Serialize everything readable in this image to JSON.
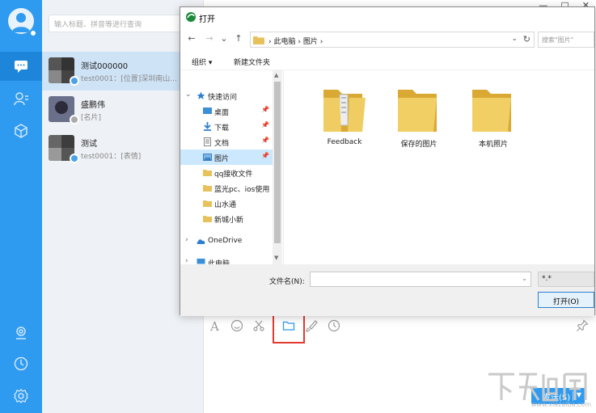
{
  "app": {
    "search_placeholder": "输入标题、拼音等进行查询",
    "window_controls": [
      "—",
      "□",
      "✕"
    ]
  },
  "rail": {
    "icons": [
      "user-avatar",
      "chat-icon",
      "contacts-icon",
      "cube-icon",
      "location-icon",
      "clock-icon",
      "settings-icon"
    ]
  },
  "conversations": [
    {
      "name": "测试000000",
      "preview": "test0001：[位置]深圳南山...",
      "active": true
    },
    {
      "name": "盛鹏伟",
      "preview": "[名片]",
      "active": false
    },
    {
      "name": "测试",
      "preview": "test0001：[表情]",
      "active": false
    }
  ],
  "dialog": {
    "title": "打开",
    "nav": {
      "back": "←",
      "forward": "→",
      "recent": "⌄",
      "up": "↑"
    },
    "breadcrumb": [
      "此电脑",
      "›",
      "图片",
      "›"
    ],
    "search_placeholder": "搜索\"图片\"",
    "commands": {
      "organize": "组织 ▾",
      "new_folder": "新建文件夹"
    },
    "nav_pane": {
      "quick_access": "快速访问",
      "items": [
        {
          "label": "桌面",
          "pinned": true
        },
        {
          "label": "下载",
          "pinned": true
        },
        {
          "label": "文档",
          "pinned": true
        },
        {
          "label": "图片",
          "pinned": true,
          "selected": true
        },
        {
          "label": "qq接收文件",
          "pinned": false
        },
        {
          "label": "蓝光pc、ios使用",
          "pinned": false
        },
        {
          "label": "山水通",
          "pinned": false
        },
        {
          "label": "新城小新",
          "pinned": false
        }
      ],
      "onedrive": "OneDrive",
      "this_pc": "此电脑"
    },
    "files": [
      "Feedback",
      "保存的图片",
      "本机照片"
    ],
    "filename_label": "文件名(N):",
    "filename_value": "",
    "file_type": "*.*",
    "open_button": "打开(O)"
  },
  "composer": {
    "tools": [
      "font-icon",
      "emoji-icon",
      "scissors-icon",
      "folder-icon",
      "brush-icon",
      "clock-icon",
      "pin-icon"
    ],
    "send_label": "发送(S)"
  },
  "watermark": "www.xiazaiba.com"
}
